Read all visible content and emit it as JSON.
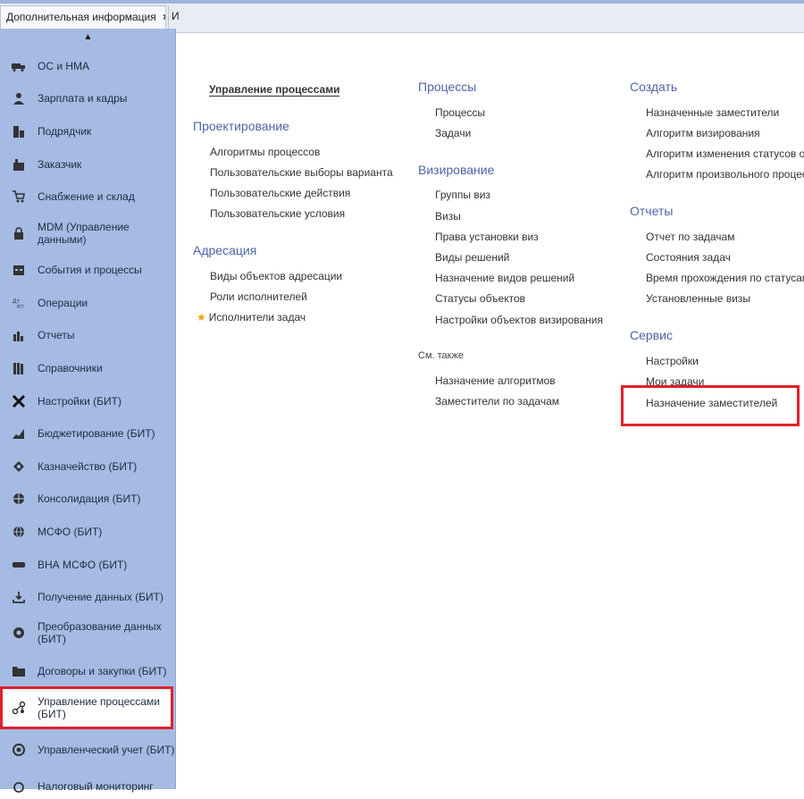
{
  "tabs": {
    "active_label": "Дополнительная информация",
    "close_glyph": "×",
    "next_label": "И"
  },
  "sidebar": {
    "scroll_up_glyph": "▲",
    "items": [
      {
        "label": "ОС и НМА",
        "icon": "truck-icon"
      },
      {
        "label": "Зарплата и кадры",
        "icon": "person-icon"
      },
      {
        "label": "Подрядчик",
        "icon": "building-icon"
      },
      {
        "label": "Заказчик",
        "icon": "factory-icon"
      },
      {
        "label": "Снабжение и склад",
        "icon": "cart-icon"
      },
      {
        "label": "MDM (Управление данными)",
        "icon": "lock-icon"
      },
      {
        "label": "События и процессы",
        "icon": "calendar-icon"
      },
      {
        "label": "Операции",
        "icon": "operations-icon"
      },
      {
        "label": "Отчеты",
        "icon": "bar-chart-icon"
      },
      {
        "label": "Справочники",
        "icon": "books-icon"
      },
      {
        "label": "Настройки (БИТ)",
        "icon": "tools-icon"
      },
      {
        "label": "Бюджетирование (БИТ)",
        "icon": "budget-chart-icon"
      },
      {
        "label": "Казначейство (БИТ)",
        "icon": "treasury-icon"
      },
      {
        "label": "Консолидация (БИТ)",
        "icon": "consolidation-icon"
      },
      {
        "label": "МСФО (БИТ)",
        "icon": "globe-icon"
      },
      {
        "label": "ВНА МСФО (БИТ)",
        "icon": "vehicle-icon"
      },
      {
        "label": "Получение данных (БИТ)",
        "icon": "download-icon"
      },
      {
        "label": "Преобразование данных (БИТ)",
        "icon": "transform-icon"
      },
      {
        "label": "Договоры и закупки (БИТ)",
        "icon": "folder-icon"
      },
      {
        "label": "Управление процессами (БИТ)",
        "icon": "process-nodes-icon"
      },
      {
        "label": "Управленческий учет (БИТ)",
        "icon": "target-icon"
      },
      {
        "label": "Налоговый мониторинг",
        "icon": "monitor-icon"
      }
    ]
  },
  "main": {
    "col1": {
      "current": "Управление процессами",
      "design_header": "Проектирование",
      "design_items": [
        "Алгоритмы процессов",
        "Пользовательские выборы варианта",
        "Пользовательские действия",
        "Пользовательские условия"
      ],
      "addr_header": "Адресация",
      "addr_items": [
        "Виды объектов адресации",
        "Роли исполнителей"
      ],
      "favorite_item": "Исполнители задач",
      "star_glyph": "★"
    },
    "col2": {
      "processes_header": "Процессы",
      "processes_items": [
        "Процессы",
        "Задачи"
      ],
      "visa_header": "Визирование",
      "visa_items": [
        "Группы виз",
        "Визы",
        "Права установки виз",
        "Виды решений",
        "Назначение видов решений",
        "Статусы объектов",
        "Настройки объектов визирования"
      ],
      "see_also": "См. также",
      "see_also_items": [
        "Назначение алгоритмов",
        "Заместители по задачам"
      ]
    },
    "col3": {
      "create_header": "Создать",
      "create_items": [
        "Назначенные заместители",
        "Алгоритм визирования",
        "Алгоритм изменения статусов об",
        "Алгоритм произвольного процесс"
      ],
      "reports_header": "Отчеты",
      "reports_items": [
        "Отчет по задачам",
        "Состояния задач",
        "Время прохождения по статусам",
        "Установленные визы"
      ],
      "service_header": "Сервис",
      "service_items": [
        "Настройки",
        "Мои задачи",
        "Назначение заместителей"
      ]
    }
  },
  "colors": {
    "sidebar_bg": "#a6bbe3",
    "header_blue": "#4c64a8",
    "highlight_red": "#e0202a",
    "star": "#f2a100"
  }
}
